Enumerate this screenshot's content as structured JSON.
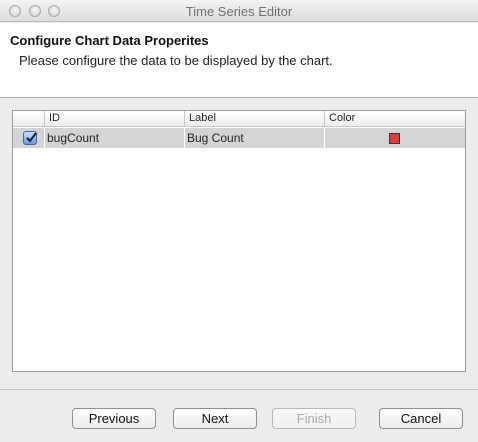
{
  "window": {
    "title": "Time Series Editor"
  },
  "header": {
    "title": "Configure Chart Data Properites",
    "subtitle": "Please configure the data to be displayed by the chart."
  },
  "table": {
    "columns": [
      "",
      "ID",
      "Label",
      "Color"
    ],
    "rows": [
      {
        "checked": true,
        "id": "bugCount",
        "label": "Bug Count",
        "color": "#e23b3b"
      }
    ]
  },
  "buttons": {
    "previous": "Previous",
    "next": "Next",
    "finish": "Finish",
    "cancel": "Cancel"
  },
  "colors": {
    "selected_row": "#d4d4d4",
    "swatch": "#e23b3b"
  }
}
